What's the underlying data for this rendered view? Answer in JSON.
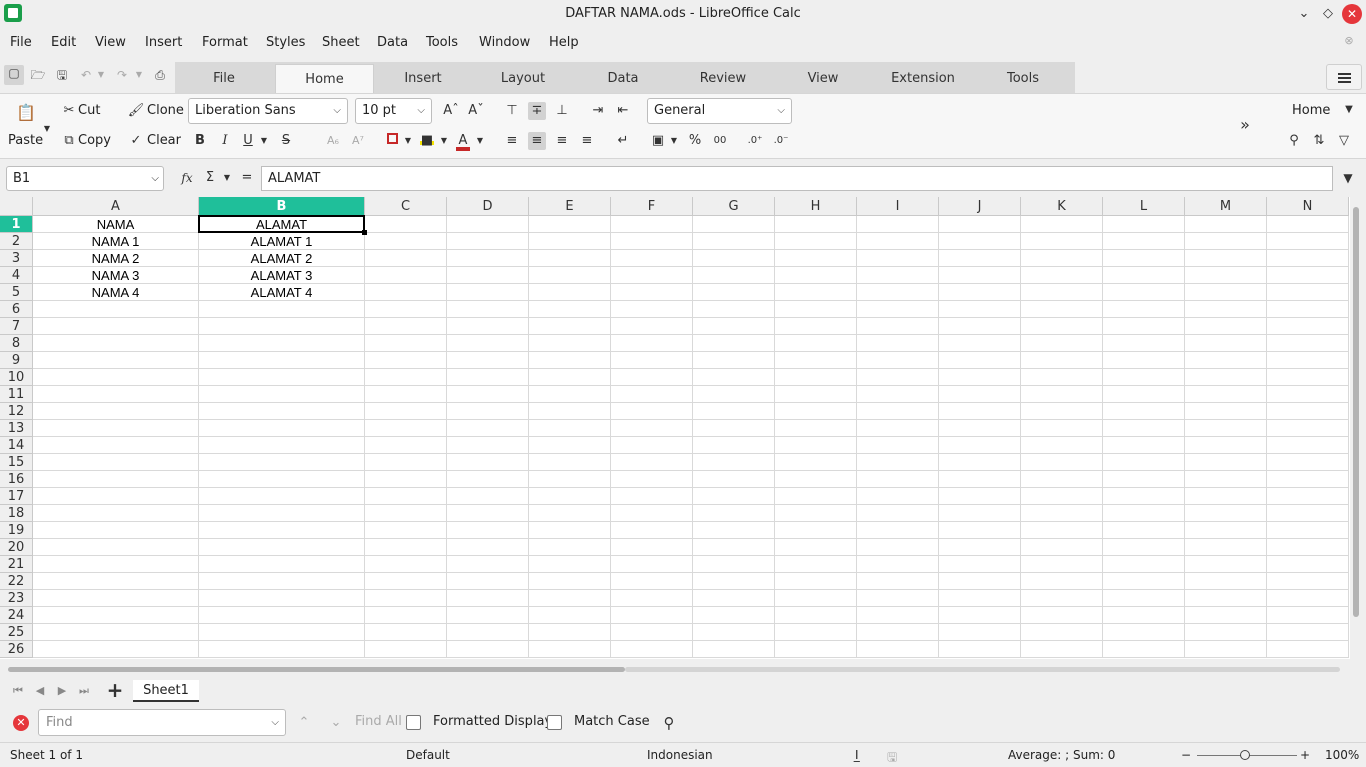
{
  "window": {
    "title": "DAFTAR NAMA.ods - LibreOffice Calc"
  },
  "menu": [
    "File",
    "Edit",
    "View",
    "Insert",
    "Format",
    "Styles",
    "Sheet",
    "Data",
    "Tools",
    "Window",
    "Help"
  ],
  "tabs": [
    "File",
    "Home",
    "Insert",
    "Layout",
    "Data",
    "Review",
    "View",
    "Extension",
    "Tools"
  ],
  "active_tab": "Home",
  "ribbon": {
    "paste": "Paste",
    "cut": "Cut",
    "copy": "Copy",
    "clone": "Clone",
    "clear": "Clear",
    "font_name": "Liberation Sans",
    "font_size": "10 pt",
    "number_format": "General",
    "bold": "B",
    "italic": "I",
    "underline": "U",
    "strike": "S",
    "percent": "%",
    "decimal": "00",
    "context_label": "Home"
  },
  "formula_bar": {
    "name_box": "B1",
    "fx": "fx",
    "sigma": "Σ",
    "equals": "=",
    "content": "ALAMAT"
  },
  "grid": {
    "columns": [
      "A",
      "B",
      "C",
      "D",
      "E",
      "F",
      "G",
      "H",
      "I",
      "J",
      "K",
      "L",
      "M",
      "N"
    ],
    "rows": [
      "1",
      "2",
      "3",
      "4",
      "5",
      "6",
      "7",
      "8",
      "9",
      "10",
      "11",
      "12",
      "13",
      "14",
      "15",
      "16",
      "17",
      "18",
      "19",
      "20",
      "21",
      "22",
      "23",
      "24",
      "25",
      "26"
    ],
    "selected_col": "B",
    "selected_row": "1",
    "cells": [
      [
        "NAMA",
        "ALAMAT"
      ],
      [
        "NAMA 1",
        "ALAMAT 1"
      ],
      [
        "NAMA 2",
        "ALAMAT 2"
      ],
      [
        "NAMA 3",
        "ALAMAT 3"
      ],
      [
        "NAMA 4",
        "ALAMAT 4"
      ]
    ]
  },
  "sheet_tabs": [
    "Sheet1"
  ],
  "find_bar": {
    "placeholder": "Find",
    "find_all": "Find All",
    "formatted_display": "Formatted Display",
    "match_case": "Match Case"
  },
  "status_bar": {
    "sheet": "Sheet 1 of 1",
    "page_style": "Default",
    "language": "Indonesian",
    "summary": "Average: ; Sum: 0",
    "zoom": "100%",
    "zoom_minus": "−",
    "zoom_plus": "+"
  }
}
